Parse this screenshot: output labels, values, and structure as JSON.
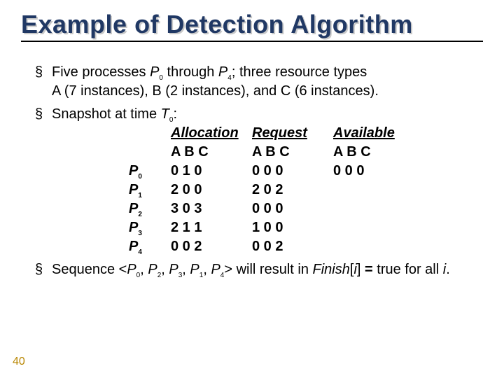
{
  "title": "Example of Detection Algorithm",
  "page_number": "40",
  "bullets": {
    "b1_pre": "Five processes ",
    "b1_p0": "P",
    "b1_p0sub": "0",
    "b1_mid1": " through ",
    "b1_p4": "P",
    "b1_p4sub": "4",
    "b1_rest": "; three resource types",
    "b1_line2": "A (7 instances), B (2 instances), and C (6 instances).",
    "b2_pre": "Snapshot at time ",
    "b2_t": "T",
    "b2_tsub": "0",
    "b2_post": ":",
    "b3_pre": "Sequence <",
    "b3_mid": "> will result in ",
    "b3_fin": "Finish",
    "b3_brkL": "[",
    "b3_i": "i",
    "b3_brkR": "] ",
    "b3_eq": "=",
    "b3_true": " true for all ",
    "b3_i2": "i",
    "b3_dot": "."
  },
  "headers": {
    "allocation": "Allocation",
    "request": "Request",
    "available": "Available",
    "abc": "A B C"
  },
  "seq": {
    "p0": "P",
    "s0": "0",
    "p2": "P",
    "s2": "2",
    "p3": "P",
    "s3": "3",
    "p1": "P",
    "s1": "1",
    "p4": "P",
    "s4": "4",
    "comma": ", "
  },
  "rows": [
    {
      "proc": "P",
      "sub": "0",
      "alloc": "0 1 0",
      "req": "0 0 0",
      "avail": "0 0 0"
    },
    {
      "proc": "P",
      "sub": "1",
      "alloc": "2 0 0",
      "req": "2 0 2",
      "avail": ""
    },
    {
      "proc": "P",
      "sub": "2",
      "alloc": "3 0 3",
      "req": "0 0 0",
      "avail": ""
    },
    {
      "proc": "P",
      "sub": "3",
      "alloc": "2 1 1",
      "req": "1 0 0",
      "avail": ""
    },
    {
      "proc": "P",
      "sub": "4",
      "alloc": "0 0 2",
      "req": "0 0 2",
      "avail": ""
    }
  ]
}
